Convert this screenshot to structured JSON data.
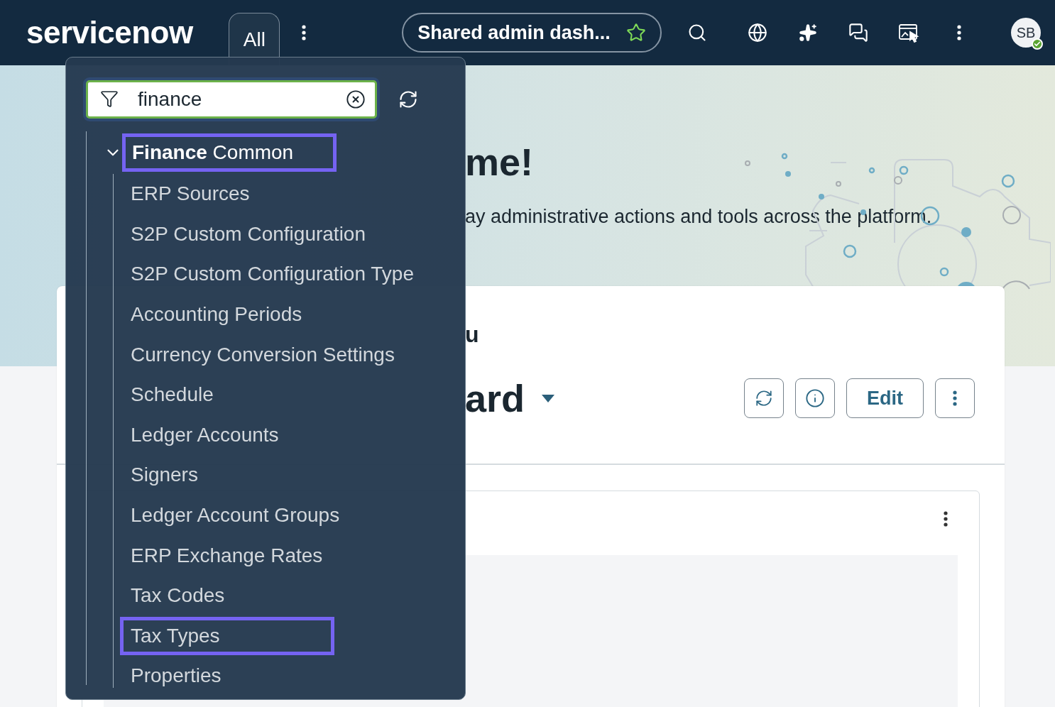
{
  "top_bar": {
    "logo": "servicenow",
    "tabs": [
      {
        "label": "All",
        "selected": true
      }
    ],
    "workspace_pill": {
      "title": "Shared admin dash...",
      "favorite": true
    },
    "avatar": {
      "initials": "SB",
      "online": true
    }
  },
  "hero": {
    "heading_end": "me!",
    "subtitle_end": "ay administrative actions and tools across the platform."
  },
  "dashboard_card": {
    "section_title_end": "u",
    "title_end": "ard",
    "buttons": [
      {
        "kind": "refresh"
      },
      {
        "kind": "info"
      },
      {
        "kind": "text",
        "label": "Edit"
      },
      {
        "kind": "more"
      }
    ]
  },
  "nav_menu": {
    "filter": {
      "value": "finance"
    },
    "tree": [
      {
        "label": "**Finance** Common",
        "expanded": true,
        "highlighted": true,
        "children": [
          {
            "label": "ERP Sources",
            "highlighted": false
          },
          {
            "label": "S2P Custom Configuration",
            "highlighted": false
          },
          {
            "label": "S2P Custom Configuration Type",
            "highlighted": false
          },
          {
            "label": "Accounting Periods",
            "highlighted": false
          },
          {
            "label": "Currency Conversion Settings",
            "highlighted": false
          },
          {
            "label": "Schedule",
            "highlighted": false
          },
          {
            "label": "Ledger Accounts",
            "highlighted": false
          },
          {
            "label": "Signers",
            "highlighted": false
          },
          {
            "label": "Ledger Account Groups",
            "highlighted": false
          },
          {
            "label": "ERP Exchange Rates",
            "highlighted": false
          },
          {
            "label": "Tax Codes",
            "highlighted": false
          },
          {
            "label": "Tax Types",
            "highlighted": true
          },
          {
            "label": "Properties",
            "highlighted": false
          }
        ]
      }
    ]
  }
}
